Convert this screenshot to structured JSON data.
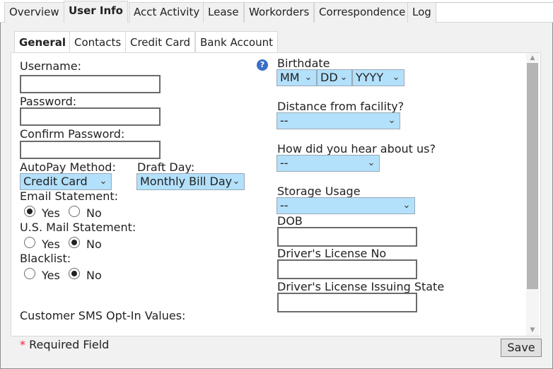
{
  "top_tabs": [
    "Overview",
    "User Info",
    "Acct Activity",
    "Lease",
    "Workorders",
    "Correspondence",
    "Log"
  ],
  "top_active": "User Info",
  "sub_tabs": [
    "General",
    "Contacts",
    "Credit Card",
    "Bank Account"
  ],
  "sub_active": "General",
  "left": {
    "username_label": "Username:",
    "username_value": "",
    "password_label": "Password:",
    "password_value": "",
    "confirm_password_label": "Confirm Password:",
    "confirm_password_value": "",
    "autopay_label": "AutoPay Method:",
    "autopay_value": "Credit Card",
    "draft_day_label": "Draft Day:",
    "draft_day_value": "Monthly Bill Day",
    "email_statement_label": "Email Statement:",
    "usmail_statement_label": "U.S. Mail Statement:",
    "blacklist_label": "Blacklist:",
    "yes_label": "Yes",
    "no_label": "No",
    "email_statement_selected": "Yes",
    "usmail_statement_selected": "No",
    "blacklist_selected": "No",
    "sms_label": "Customer SMS Opt-In Values:"
  },
  "right": {
    "birthdate_label": "Birthdate",
    "birth_month": "MM",
    "birth_day": "DD",
    "birth_year": "YYYY",
    "distance_label": "Distance from facility?",
    "distance_value": "--",
    "hear_label": "How did you hear about us?",
    "hear_value": "--",
    "storage_label": "Storage Usage",
    "storage_value": "--",
    "dob_label": "DOB",
    "dob_value": "",
    "license_label": "Driver's License No",
    "license_value": "",
    "license_state_label": "Driver's License Issuing State",
    "license_state_value": ""
  },
  "footer": {
    "required_star": "*",
    "required_text": "Required Field",
    "save_label": "Save"
  },
  "colors": {
    "select_bg": "#b3e0fb",
    "required_star": "#e23"
  }
}
